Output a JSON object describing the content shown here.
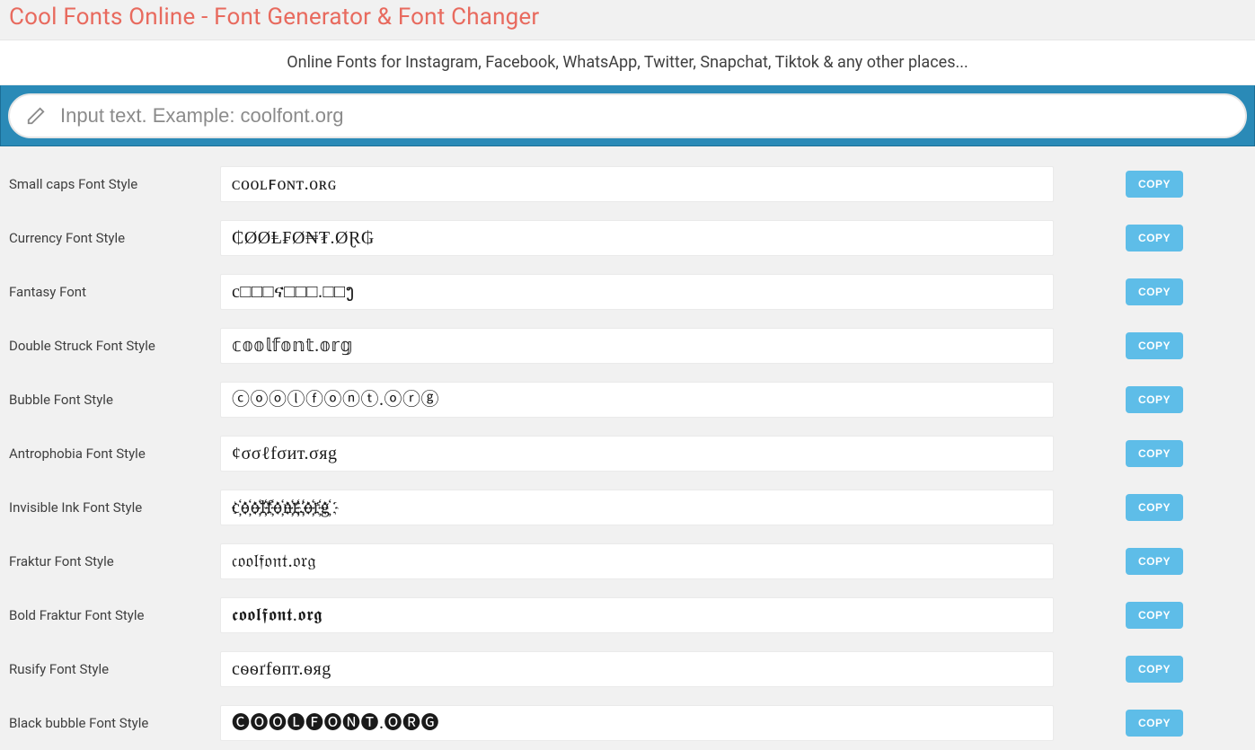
{
  "header": {
    "title": "Cool Fonts Online - Font Generator & Font Changer",
    "subtitle": "Online Fonts for Instagram, Facebook, WhatsApp, Twitter, Snapchat, Tiktok & any other places..."
  },
  "input": {
    "placeholder": "Input text. Example: coolfont.org",
    "value": ""
  },
  "copy_label": "COPY",
  "styles": [
    {
      "label": "Small caps Font Style",
      "value": "ᴄᴏᴏʟꜰᴏɴᴛ.ᴏʀɢ"
    },
    {
      "label": "Currency Font Style",
      "value": "₵ØØⱠ₣Ø₦₮.ØⱤ₲"
    },
    {
      "label": "Fantasy Font",
      "value": "c□□□ና□□□.□□ງ"
    },
    {
      "label": "Double Struck Font Style",
      "value": "𝕔𝕠𝕠𝕝𝕗𝕠𝕟𝕥.𝕠𝕣𝕘"
    },
    {
      "label": "Bubble Font Style",
      "value": "ⓒⓞⓞⓛⓕⓞⓝⓣ.ⓞⓡⓖ"
    },
    {
      "label": "Antrophobia Font Style",
      "value": "¢σσℓfσит.σяg"
    },
    {
      "label": "Invisible Ink Font Style",
      "value": "c҉o҉o҉l҉f҉o҉n҉t҉.҉o҉r҉g҉"
    },
    {
      "label": "Fraktur Font Style",
      "value": "𝔠𝔬𝔬𝔩𝔣𝔬𝔫𝔱.𝔬𝔯𝔤"
    },
    {
      "label": "Bold Fraktur Font Style",
      "value": "𝖈𝖔𝖔𝖑𝖋𝖔𝖓𝖙.𝖔𝖗𝖌"
    },
    {
      "label": "Rusify Font Style",
      "value": "cѳѳґfѳпт.ѳяg"
    },
    {
      "label": "Black bubble Font Style",
      "value": "🅒🅞🅞🅛🅕🅞🅝🅣.🅞🅡🅖"
    }
  ]
}
